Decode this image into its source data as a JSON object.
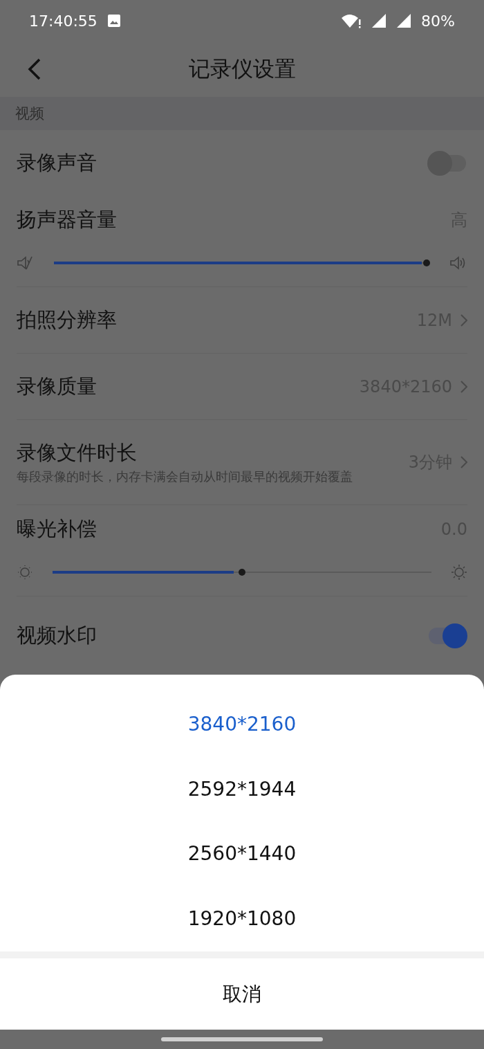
{
  "status_bar": {
    "time": "17:40:55",
    "battery": "80%"
  },
  "header": {
    "title": "记录仪设置"
  },
  "section": {
    "title": "视频"
  },
  "settings": [
    {
      "kind": "toggle",
      "label": "录像声音",
      "on": false
    },
    {
      "kind": "volume-slider",
      "label": "扬声器音量",
      "value": "高",
      "level": 1.0
    },
    {
      "kind": "nav",
      "label": "拍照分辨率",
      "value": "12M"
    },
    {
      "kind": "nav",
      "label": "录像质量",
      "value": "3840*2160"
    },
    {
      "kind": "nav",
      "label": "录像文件时长",
      "description": "每段录像的时长，内存卡满会自动从时间最早的视频开始覆盖",
      "value": "3分钟"
    },
    {
      "kind": "brightness-slider",
      "label": "曝光补偿",
      "value": "0.0",
      "level": 0.5
    },
    {
      "kind": "toggle",
      "label": "视频水印",
      "on": true
    }
  ],
  "sheet": {
    "options": [
      {
        "label": "3840*2160",
        "selected": true
      },
      {
        "label": "2592*1944",
        "selected": false
      },
      {
        "label": "2560*1440",
        "selected": false
      },
      {
        "label": "1920*1080",
        "selected": false
      }
    ],
    "cancel": "取消"
  }
}
